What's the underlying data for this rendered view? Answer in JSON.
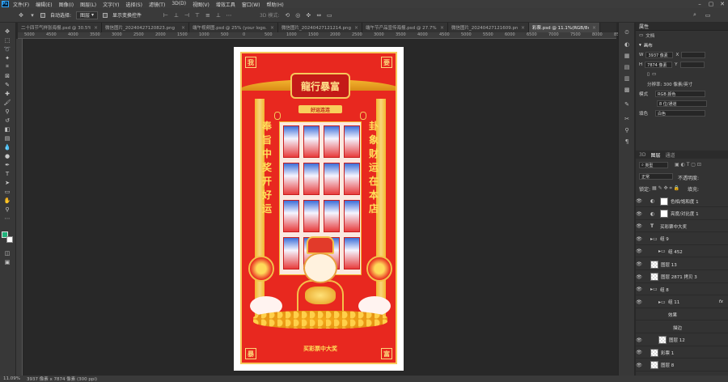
{
  "app": {
    "logo": "Ps"
  },
  "menu": [
    "文件(F)",
    "编辑(E)",
    "图像(I)",
    "图层(L)",
    "文字(Y)",
    "选择(S)",
    "滤镜(T)",
    "3D(D)",
    "视图(V)",
    "增效工具",
    "窗口(W)",
    "帮助(H)"
  ],
  "options": {
    "auto_select_label": "自动选择:",
    "auto_select_value": "图层",
    "show_transform_label": "显示变换控件",
    "mode_3d_label": "3D 模式:"
  },
  "tabs": [
    {
      "label": "二十四节气样张海报.psd @ 30.5%..."
    },
    {
      "label": "微信图片_20240427120823.png"
    },
    {
      "label": "端午视频图.psd @ 25% (your logo..."
    },
    {
      "label": "微信图片_20240427121214.png"
    },
    {
      "label": "端午节产品宣传海报.psd @ 27.7%..."
    },
    {
      "label": "微信图片_20240427121609.png"
    },
    {
      "label": "彩票.psd @ 11.1%(RGB/8#) *",
      "active": true
    }
  ],
  "ruler_marks": [
    "5000",
    "4500",
    "4000",
    "3500",
    "3000",
    "2500",
    "2000",
    "1500",
    "1000",
    "500",
    "0",
    "500",
    "1000",
    "1500",
    "2000",
    "2500",
    "3000",
    "3500",
    "4000",
    "4500",
    "5000",
    "5500",
    "6000",
    "6500",
    "7000",
    "7500",
    "8000",
    "8500"
  ],
  "poster": {
    "corner_tl": "我",
    "corner_tr": "要",
    "corner_bl": "暴",
    "corner_br": "富",
    "plaque_text": "龍行暴富",
    "banner_text": "好运连连",
    "couplet_left": [
      "奉",
      "旨",
      "中",
      "奖",
      "开",
      "好",
      "运"
    ],
    "couplet_right": [
      "卦",
      "象",
      "财",
      "运",
      "在",
      "本",
      "店"
    ],
    "bottom_text": "买彩票中大奖"
  },
  "status": {
    "zoom": "11.09%",
    "dimensions": "3937 像素 x 7874 像素 (300 ppi)"
  },
  "properties": {
    "title": "属性",
    "doc_label": "文档",
    "canvas_label": "画布",
    "w_label": "W",
    "w_value": "3937 像素",
    "x_label": "X",
    "h_label": "H",
    "h_value": "7874 像素",
    "y_label": "Y",
    "resolution": "分辨率: 300 像素/英寸",
    "mode_label": "模式",
    "mode_value": "RGB 颜色",
    "depth_value": "8 位/通道",
    "fill_label": "填色",
    "fill_value": "白色"
  },
  "layers_panel": {
    "tabs": [
      "3D",
      "图层",
      "通道"
    ],
    "filter_label": "类型",
    "blend_mode": "正常",
    "opacity_label": "不透明度:",
    "lock_label": "锁定:",
    "fill_label": "填充:",
    "items": [
      {
        "name": "色相/饱和度 1",
        "kind": "adj"
      },
      {
        "name": "亮度/对比度 1",
        "kind": "adj"
      },
      {
        "name": "买彩票中大奖",
        "kind": "text"
      },
      {
        "name": "组 9",
        "kind": "group"
      },
      {
        "name": "组 452",
        "kind": "group"
      },
      {
        "name": "图层 13",
        "kind": "layer"
      },
      {
        "name": "图层 2871 拷贝 3",
        "kind": "layer"
      },
      {
        "name": "组 8",
        "kind": "group"
      },
      {
        "name": "组 11",
        "kind": "group",
        "fx": "fx"
      },
      {
        "name": "效果",
        "kind": "effect"
      },
      {
        "name": "描边",
        "kind": "effect"
      },
      {
        "name": "图层 12",
        "kind": "layer"
      },
      {
        "name": "彩票 1",
        "kind": "layer"
      },
      {
        "name": "图层 8",
        "kind": "layer"
      }
    ]
  }
}
